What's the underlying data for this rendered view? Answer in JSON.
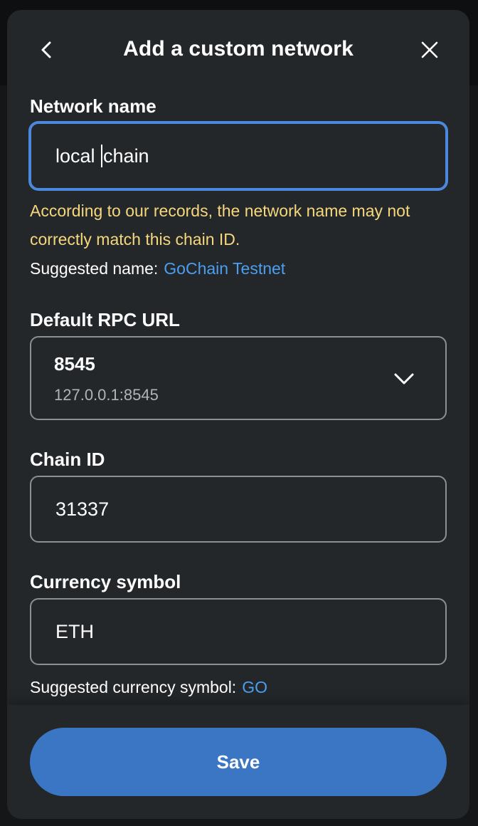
{
  "header": {
    "title": "Add a custom network",
    "back_icon": "chevron-left-icon",
    "close_icon": "close-icon"
  },
  "network_name": {
    "label": "Network name",
    "value_before_caret": "local ",
    "value_after_caret": "chain",
    "warning": "According to our records, the network name may not correctly match this chain ID.",
    "suggestion_label": "Suggested name:",
    "suggestion_value": "GoChain Testnet"
  },
  "rpc": {
    "label": "Default RPC URL",
    "selected_name": "8545",
    "selected_url": "127.0.0.1:8545",
    "dropdown_icon": "chevron-down-icon"
  },
  "chain_id": {
    "label": "Chain ID",
    "value": "31337"
  },
  "currency": {
    "label": "Currency symbol",
    "value": "ETH",
    "suggestion_label": "Suggested currency symbol:",
    "suggestion_value": "GO"
  },
  "footer": {
    "save_label": "Save"
  },
  "colors": {
    "modal_bg": "#24272a",
    "accent": "#3a76c4",
    "link": "#4a9ff0",
    "warning": "#f5d77c",
    "focus": "#4a89dc"
  }
}
